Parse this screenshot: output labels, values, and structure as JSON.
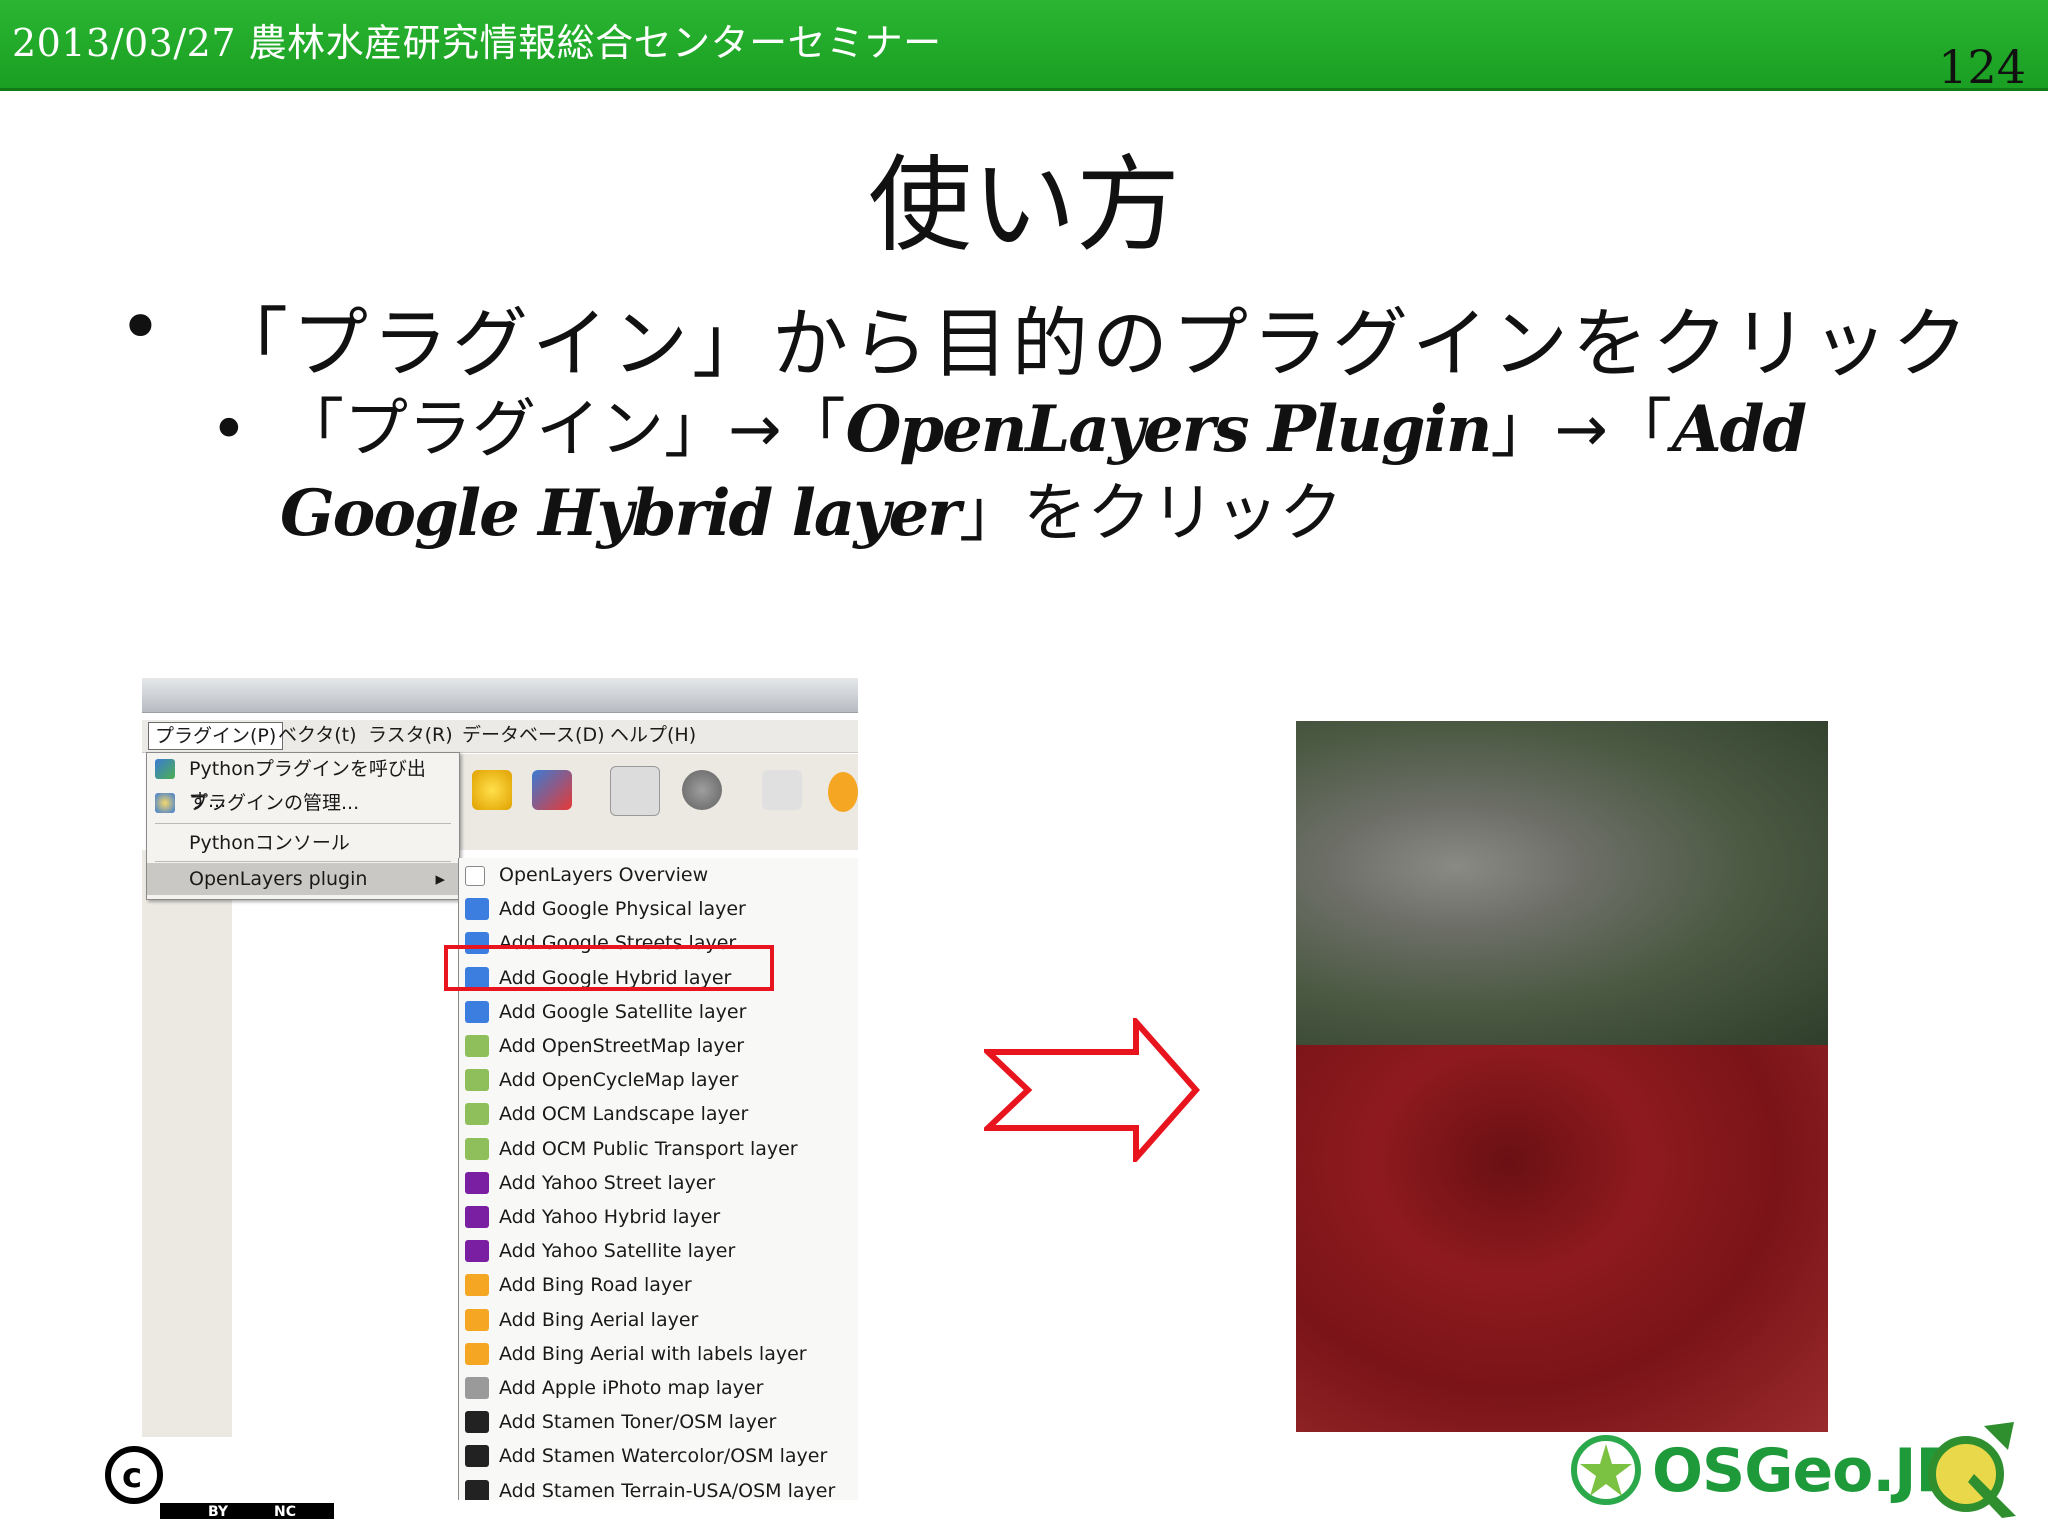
{
  "header": {
    "date_title": "2013/03/27 農林水産研究情報総合センターセミナー",
    "page_number": "124"
  },
  "title": "使い方",
  "bullets": {
    "level1": "「プラグイン」から目的のプラグインをクリック",
    "level2_prefix": "「プラグイン」→「",
    "level2_plugin": "OpenLayers Plugin",
    "level2_mid": "」→「",
    "level2_item": "Add Google Hybrid layer",
    "level2_suffix": "」をクリック"
  },
  "qgis": {
    "menubar": [
      "プラグイン(P)",
      "ベクタ(t)",
      "ラスタ(R)",
      "データベース(D)",
      "ヘルプ(H)"
    ],
    "plugin_menu": [
      {
        "label": "Pythonプラグインを呼び出す...",
        "icon": "python-plugin-icon"
      },
      {
        "label": "プラグインの管理...",
        "icon": "plugin-manager-icon"
      },
      {
        "label": "Pythonコンソール",
        "icon": ""
      },
      {
        "label": "OpenLayers plugin",
        "icon": "",
        "submenu_arrow": "▸"
      }
    ],
    "openlayers_menu": [
      {
        "label": "OpenLayers Overview",
        "icon": "checkbox-icon",
        "color": "#ffffff"
      },
      {
        "label": "Add Google Physical layer",
        "icon": "google-icon",
        "color": "#3c7de0"
      },
      {
        "label": "Add Google Streets layer",
        "icon": "google-icon",
        "color": "#3c7de0"
      },
      {
        "label": "Add Google Hybrid layer",
        "icon": "google-icon",
        "color": "#3c7de0"
      },
      {
        "label": "Add Google Satellite layer",
        "icon": "google-icon",
        "color": "#3c7de0"
      },
      {
        "label": "Add OpenStreetMap layer",
        "icon": "osm-icon",
        "color": "#8fbf5a"
      },
      {
        "label": "Add OpenCycleMap layer",
        "icon": "osm-icon",
        "color": "#8fbf5a"
      },
      {
        "label": "Add OCM Landscape layer",
        "icon": "osm-icon",
        "color": "#8fbf5a"
      },
      {
        "label": "Add OCM Public Transport layer",
        "icon": "osm-icon",
        "color": "#8fbf5a"
      },
      {
        "label": "Add Yahoo Street layer",
        "icon": "yahoo-icon",
        "color": "#7b1fa2"
      },
      {
        "label": "Add Yahoo Hybrid layer",
        "icon": "yahoo-icon",
        "color": "#7b1fa2"
      },
      {
        "label": "Add Yahoo Satellite layer",
        "icon": "yahoo-icon",
        "color": "#7b1fa2"
      },
      {
        "label": "Add Bing Road layer",
        "icon": "bing-icon",
        "color": "#f5a623"
      },
      {
        "label": "Add Bing Aerial layer",
        "icon": "bing-icon",
        "color": "#f5a623"
      },
      {
        "label": "Add Bing Aerial with labels layer",
        "icon": "bing-icon",
        "color": "#f5a623"
      },
      {
        "label": "Add Apple iPhoto map layer",
        "icon": "apple-icon",
        "color": "#9a9a9a"
      },
      {
        "label": "Add Stamen Toner/OSM layer",
        "icon": "stamen-icon",
        "color": "#222222"
      },
      {
        "label": "Add Stamen Watercolor/OSM layer",
        "icon": "stamen-icon",
        "color": "#222222"
      },
      {
        "label": "Add Stamen Terrain-USA/OSM layer",
        "icon": "stamen-icon",
        "color": "#222222"
      }
    ],
    "highlighted_index": 3
  },
  "colors": {
    "header_green": "#1fa827",
    "highlight_red": "#e8141e",
    "arrow_red": "#e8141e"
  },
  "cc_license": {
    "labels": [
      "BY",
      "NC"
    ]
  },
  "logo_text": "OSGeo.JP"
}
